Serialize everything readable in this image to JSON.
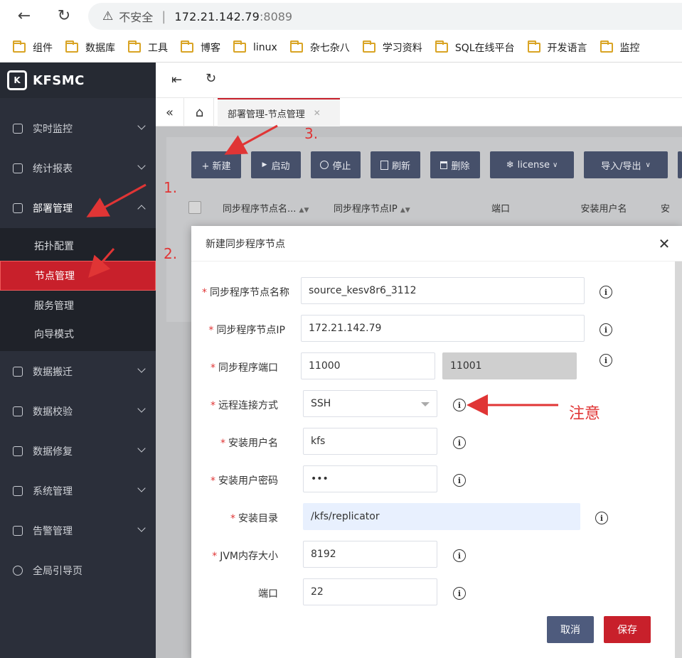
{
  "browser": {
    "insecure_label": "不安全",
    "url_host": "172.21.142.79",
    "url_port": ":8089",
    "bookmarks": [
      "组件",
      "数据库",
      "工具",
      "博客",
      "linux",
      "杂七杂八",
      "学习资料",
      "SQL在线平台",
      "开发语言",
      "监控"
    ]
  },
  "app": {
    "logo": "KFSMC"
  },
  "sidebar": {
    "items": [
      {
        "label": "实时监控"
      },
      {
        "label": "统计报表"
      },
      {
        "label": "部署管理"
      },
      {
        "label": "数据搬迁"
      },
      {
        "label": "数据校验"
      },
      {
        "label": "数据修复"
      },
      {
        "label": "系统管理"
      },
      {
        "label": "告警管理"
      },
      {
        "label": "全局引导页"
      }
    ],
    "submenu": [
      {
        "label": "拓扑配置"
      },
      {
        "label": "节点管理"
      },
      {
        "label": "服务管理"
      },
      {
        "label": "向导模式"
      }
    ]
  },
  "tabs": {
    "active": "部署管理-节点管理"
  },
  "toolbar": {
    "new": "+ 新建",
    "start": "启动",
    "stop": "停止",
    "refresh": "刷新",
    "delete": "删除",
    "license": "license",
    "import_export": "导入/导出"
  },
  "table": {
    "columns": [
      "同步程序节点名...",
      "同步程序节点IP",
      "端口",
      "安装用户名",
      "安"
    ]
  },
  "modal": {
    "title": "新建同步程序节点",
    "fields": {
      "node_name": {
        "label": "同步程序节点名称",
        "value": "source_kesv8r6_3112"
      },
      "node_ip": {
        "label": "同步程序节点IP",
        "value": "172.21.142.79"
      },
      "port": {
        "label": "同步程序端口",
        "value": "11000",
        "value2": "11001"
      },
      "remote_method": {
        "label": "远程连接方式",
        "value": "SSH"
      },
      "install_user": {
        "label": "安装用户名",
        "value": "kfs"
      },
      "install_password": {
        "label": "安装用户密码",
        "value": "•••"
      },
      "install_dir": {
        "label": "安装目录",
        "value": "/kfs/replicator"
      },
      "jvm_memory": {
        "label": "JVM内存大小",
        "value": "8192"
      },
      "ssh_port": {
        "label": "端口",
        "value": "22"
      }
    },
    "cancel": "取消",
    "save": "保存"
  },
  "annotations": {
    "step1": "1.",
    "step2": "2.",
    "step3": "3.",
    "note": "注意"
  },
  "colors": {
    "sidebar_bg": "#2b2f3a",
    "accent_red": "#c8202b",
    "toolbar_btn": "#46506a",
    "cancel_btn": "#4e5b7d",
    "annotation": "#e03535"
  }
}
